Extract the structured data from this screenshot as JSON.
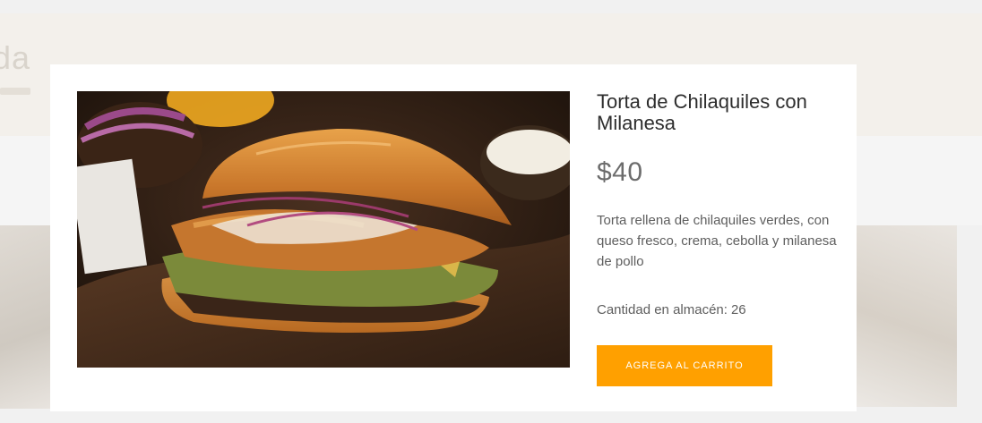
{
  "background": {
    "title_fragment": "da"
  },
  "product": {
    "title": "Torta de Chilaquiles con Milanesa",
    "price": "$40",
    "description": "Torta rellena de chilaquiles verdes, con queso fresco, crema, cebolla y milanesa de pollo",
    "stock_label": "Cantidad en almacén:",
    "stock_value": "26",
    "add_to_cart_label": "AGREGA AL CARRITO"
  },
  "colors": {
    "accent": "#ffa000",
    "text": "#2d2d2d",
    "muted": "#5e5e5e"
  }
}
